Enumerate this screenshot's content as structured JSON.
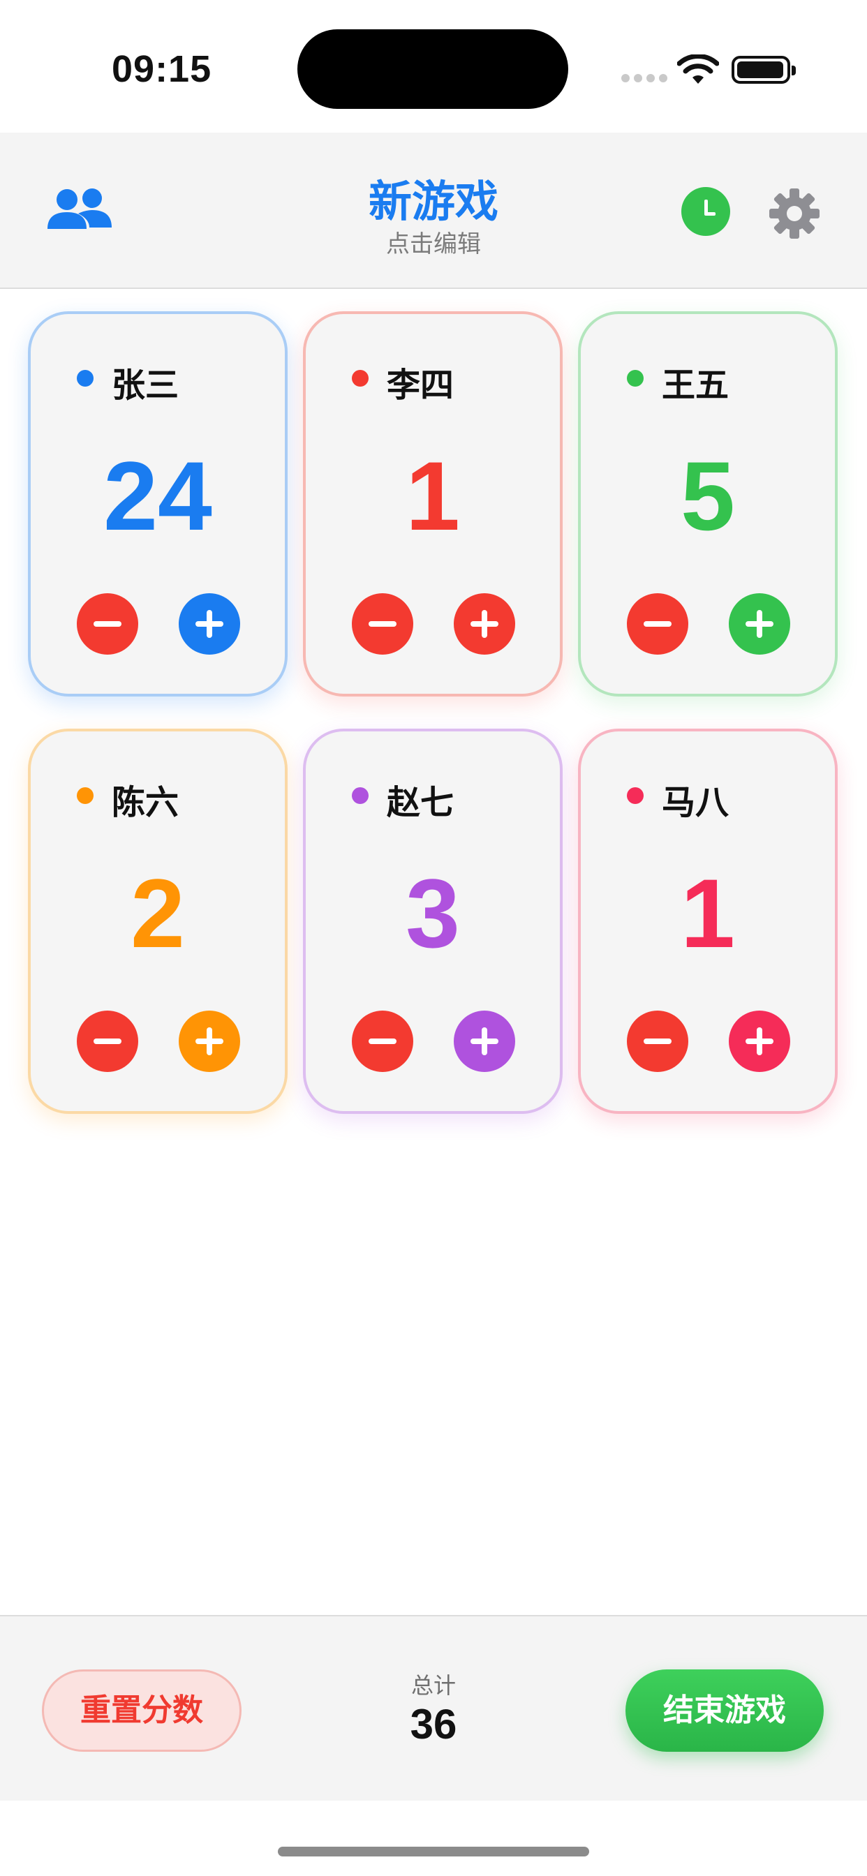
{
  "status_bar": {
    "time": "09:15"
  },
  "header": {
    "title": "新游戏",
    "subtitle": "点击编辑",
    "players_icon": "people-icon",
    "timer_icon": "clock-icon",
    "settings_icon": "gear-icon"
  },
  "players": [
    {
      "name": "张三",
      "score": "24",
      "color": "#1a7cf0",
      "border": "#a9cdf6",
      "glow": "rgba(26,124,240,0.18)"
    },
    {
      "name": "李四",
      "score": "1",
      "color": "#f33a30",
      "border": "#f7b8b2",
      "glow": "rgba(243,58,48,0.14)"
    },
    {
      "name": "王五",
      "score": "5",
      "color": "#34c24e",
      "border": "#b3e6bd",
      "glow": "rgba(52,194,78,0.14)"
    },
    {
      "name": "陈六",
      "score": "2",
      "color": "#ff9405",
      "border": "#fbd9a5",
      "glow": "rgba(255,148,5,0.16)"
    },
    {
      "name": "赵七",
      "score": "3",
      "color": "#af52de",
      "border": "#ddbdf0",
      "glow": "rgba(175,82,222,0.16)"
    },
    {
      "name": "马八",
      "score": "1",
      "color": "#f52c58",
      "border": "#f8b4c2",
      "glow": "rgba(245,44,88,0.16)"
    }
  ],
  "footer": {
    "reset_label": "重置分数",
    "total_label": "总计",
    "total_value": "36",
    "end_label": "结束游戏"
  }
}
